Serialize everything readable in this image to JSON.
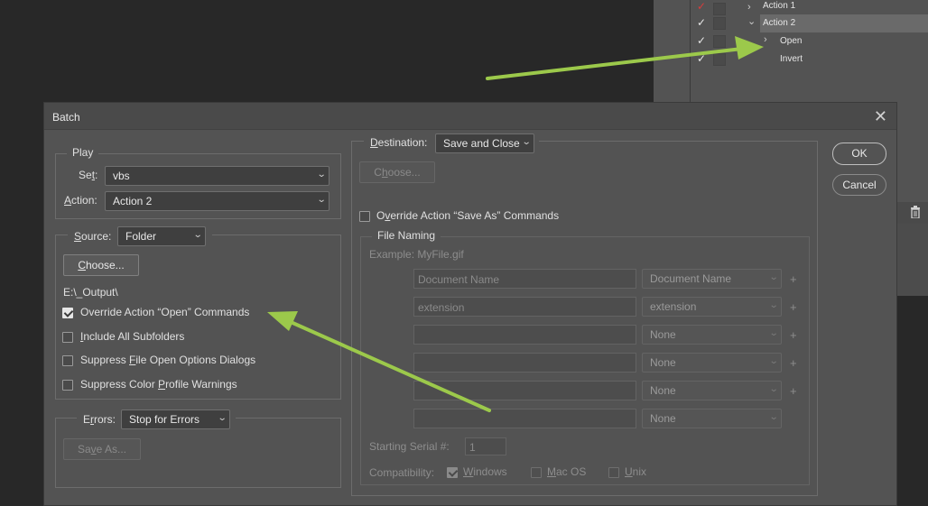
{
  "actions_panel": {
    "rows": [
      {
        "label": "Action 1",
        "check": "✓",
        "chevron": "›"
      },
      {
        "label": "Action 2",
        "check": "✓",
        "chevron": "⌄"
      },
      {
        "label": "Open",
        "check": "✓",
        "chevron": "›"
      },
      {
        "label": "Invert",
        "check": "✓",
        "chevron": ""
      }
    ],
    "trash_icon": "trash-icon"
  },
  "dialog": {
    "title": "Batch",
    "close_label": "✕",
    "ok_label": "OK",
    "cancel_label": "Cancel",
    "play": {
      "legend": "Play",
      "set_label_pre": "Se",
      "set_label_u": "t",
      "set_label_post": ":",
      "set_value": "vbs",
      "action_label_u": "A",
      "action_label_post": "ction:",
      "action_value": "Action 2"
    },
    "source": {
      "label_u": "S",
      "label_post": "ource:",
      "value": "Folder",
      "choose_label_u": "C",
      "choose_label_post": "hoose...",
      "path": "E:\\_Output\\",
      "options": [
        {
          "pre": "",
          "u": "",
          "post": "Override Action “Open” Commands",
          "checked": true
        },
        {
          "pre": "",
          "u": "I",
          "post": "nclude All Subfolders",
          "checked": false
        },
        {
          "pre": "Suppress ",
          "u": "F",
          "post": "ile Open Options Dialogs",
          "checked": false
        },
        {
          "pre": "Suppress Color ",
          "u": "P",
          "post": "rofile Warnings",
          "checked": false
        }
      ]
    },
    "errors": {
      "label_pre": "E",
      "label_u": "r",
      "label_post": "rors:",
      "value": "Stop for Errors",
      "save_as_label_pre": "Sa",
      "save_as_label_u": "v",
      "save_as_label_post": "e As..."
    },
    "destination": {
      "label_u": "D",
      "label_post": "estination:",
      "value": "Save and Close",
      "choose_label_pre": "C",
      "choose_label_u": "h",
      "choose_label_post": "oose...",
      "override_pre": "O",
      "override_u": "v",
      "override_post": "erride Action “Save As” Commands",
      "override_checked": false
    },
    "file_naming": {
      "legend": "File Naming",
      "example": "Example: MyFile.gif",
      "rows": [
        {
          "field": "Document Name",
          "select": "Document Name",
          "plus": "+"
        },
        {
          "field": "extension",
          "select": "extension",
          "plus": "+"
        },
        {
          "field": "",
          "select": "None",
          "plus": "+"
        },
        {
          "field": "",
          "select": "None",
          "plus": "+"
        },
        {
          "field": "",
          "select": "None",
          "plus": "+"
        },
        {
          "field": "",
          "select": "None",
          "plus": ""
        }
      ],
      "serial_label": "Starting Serial #:",
      "serial_value": "1",
      "compat_label": "Compatibility:",
      "compat_windows_u": "W",
      "compat_windows_post": "indows",
      "compat_windows_checked": true,
      "compat_mac_u": "M",
      "compat_mac_post": "ac OS",
      "compat_mac_checked": false,
      "compat_unix_u": "U",
      "compat_unix_post": "nix",
      "compat_unix_checked": false
    }
  },
  "annotation": {
    "arrow_color": "#9cc94b"
  }
}
